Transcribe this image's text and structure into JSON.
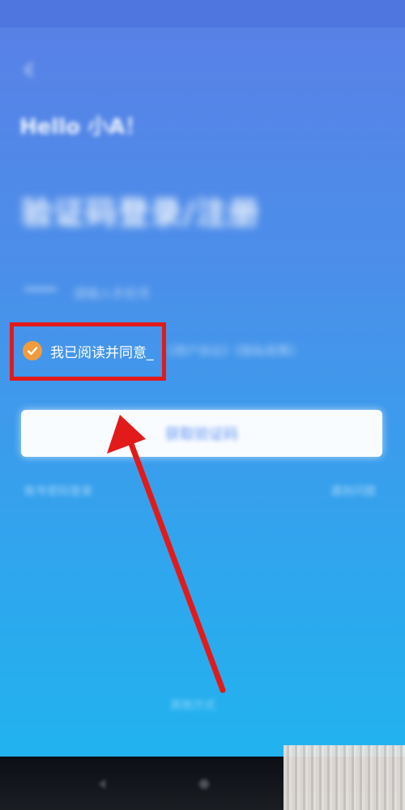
{
  "greeting": "Hello 小A！",
  "title": "验证码登录/注册",
  "phone": {
    "prefix": "",
    "placeholder": "请输入手机号"
  },
  "agreement": {
    "checked": true,
    "text": "我已阅读并同意_",
    "rest": "《用户协议》《隐私政策》"
  },
  "login": {
    "label": "获取验证码"
  },
  "links": {
    "left": "账号密码登录",
    "right": "遇到问题"
  },
  "bottom": {
    "label": "其他方式"
  },
  "colors": {
    "highlight": "#e21a1a",
    "check": "#f29b3c",
    "button_text": "#5a8ff2"
  }
}
